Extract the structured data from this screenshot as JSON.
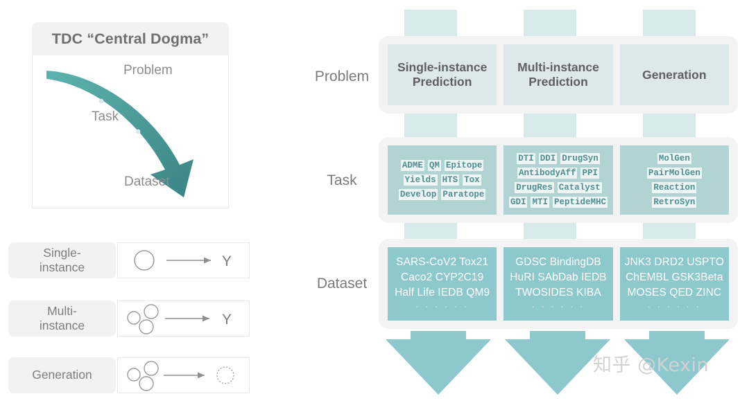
{
  "left_panel": {
    "card_title": "TDC “Central Dogma”",
    "flow_labels": {
      "problem": "Problem",
      "task": "Task",
      "dataset": "Dataset"
    },
    "legend": [
      {
        "label": "Single-\ninstance",
        "label_line1": "Single-",
        "label_line2": "instance",
        "diagram": "one-circle-arrow-Y",
        "output": "Y"
      },
      {
        "label": "Multi-\ninstance",
        "label_line1": "Multi-",
        "label_line2": "instance",
        "diagram": "three-circles-arrow-Y",
        "output": "Y"
      },
      {
        "label": "Generation",
        "label_line1": "Generation",
        "label_line2": "",
        "diagram": "three-circles-arrow-dashed-circle",
        "output": ""
      }
    ]
  },
  "right_panel": {
    "row_labels": {
      "problem": "Problem",
      "task": "Task",
      "dataset": "Dataset"
    },
    "problems": [
      {
        "line1": "Single-instance",
        "line2": "Prediction"
      },
      {
        "line1": "Multi-instance",
        "line2": "Prediction"
      },
      {
        "line1": "Generation",
        "line2": ""
      }
    ],
    "tasks": [
      {
        "lines": [
          [
            "ADME",
            "QM",
            "Epitope"
          ],
          [
            "Yields",
            "HTS",
            "Tox"
          ],
          [
            "Develop",
            "Paratope"
          ]
        ]
      },
      {
        "lines": [
          [
            "DTI",
            "DDI",
            "DrugSyn"
          ],
          [
            "AntibodyAff",
            "PPI"
          ],
          [
            "DrugRes",
            "Catalyst"
          ],
          [
            "GDI",
            "MTI",
            "PeptideMHC"
          ]
        ]
      },
      {
        "lines": [
          [
            "MolGen"
          ],
          [
            "PairMolGen"
          ],
          [
            "Reaction"
          ],
          [
            "RetroSyn"
          ]
        ]
      }
    ],
    "datasets": [
      {
        "lines": [
          "SARS-CoV2  Tox21",
          "Caco2  CYP2C19",
          "Half Life  IEDB  QM9"
        ],
        "more": "· · · · · ·"
      },
      {
        "lines": [
          "GDSC  BindingDB",
          "HuRI  SAbDab  IEDB",
          "TWOSIDES  KIBA"
        ],
        "more": "· · · · · ·"
      },
      {
        "lines": [
          "JNK3  DRD2 USPTO",
          "ChEMBL  GSK3Beta",
          "MOSES QED  ZINC"
        ],
        "more": "· · · · · ·"
      }
    ]
  },
  "watermark": "知乎 @Kexin",
  "colors": {
    "arrow_teal_dark": "#3d8a8a",
    "arrow_teal_light": "#5bb4b0",
    "problem_box": "#dde8ea",
    "task_box": "#b2d3d4",
    "task_tag_bg": "#edf5f5",
    "task_tag_text": "#4e8e91",
    "dataset_box": "#8dc8cc",
    "shell_bg": "#f3f3f3",
    "connector": "#d8e9e9",
    "big_arrow": "#8dc8cc",
    "label_text": "#7a7a7a"
  }
}
